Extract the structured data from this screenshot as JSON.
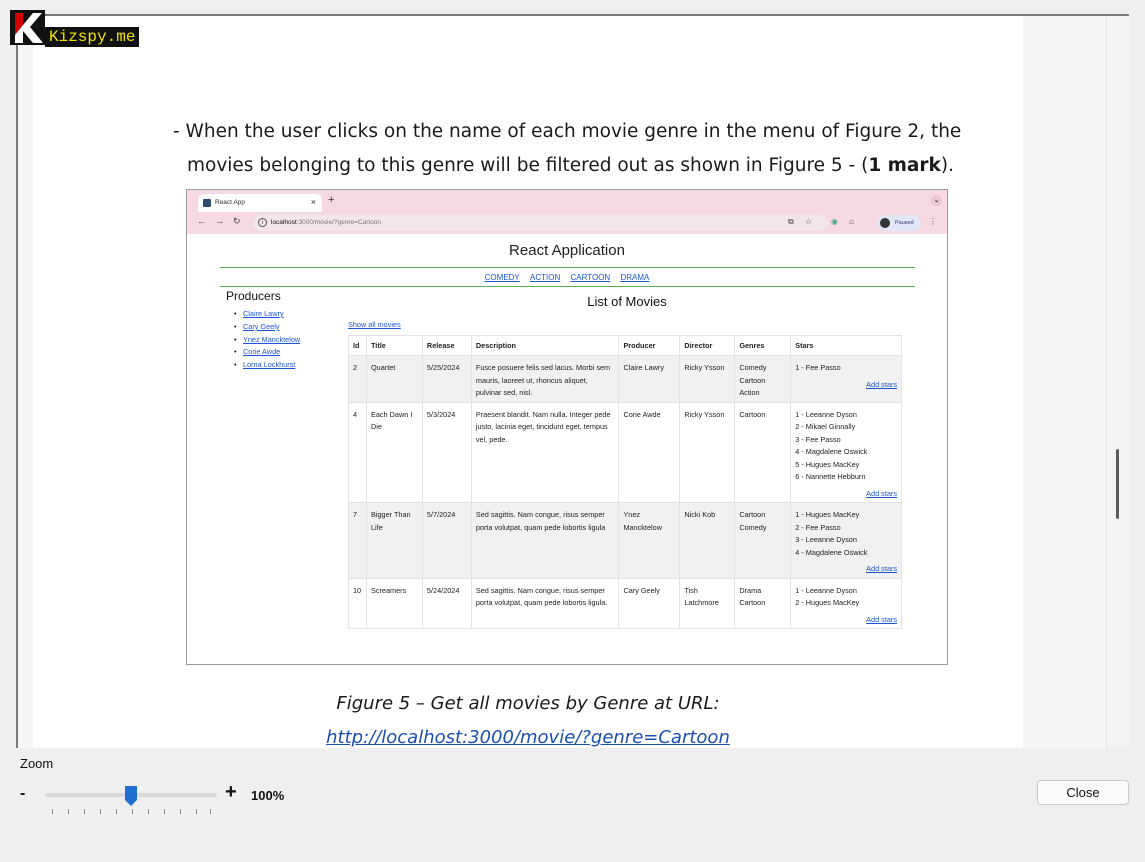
{
  "watermark": {
    "text": "Kizspy.me"
  },
  "document": {
    "line1": "- When the user clicks on the name of each movie genre in the menu of Figure 2, the",
    "line2_start": "movies belonging to this genre will be filtered out as shown in Figure 5  - (",
    "line2_bold": "1 mark",
    "line2_end": ").",
    "caption1": "Figure 5 – Get all movies by Genre at URL:",
    "caption2": "http://localhost:3000/movie/?genre=Cartoon"
  },
  "browser": {
    "tab_title": "React App",
    "tab_close": "×",
    "new_tab": "+",
    "url_host": "localhost",
    "url_path": ":3000/movie/?genre=Cartoon",
    "paused_label": "Paused",
    "icons": [
      "back-icon",
      "forward-icon",
      "reload-icon",
      "info-icon",
      "share-icon",
      "star-icon",
      "extension-icon",
      "puzzle-icon",
      "more-icon"
    ]
  },
  "app": {
    "title": "React Application",
    "genres": [
      "COMEDY",
      "ACTION",
      "CARTOON",
      "DRAMA"
    ],
    "producers_heading": "Producers",
    "producers": [
      "Claire Lawry",
      "Cary Geely",
      "Ynez Mancktelow",
      "Corie Awde",
      "Lorna Lockhurst"
    ],
    "list_heading": "List of Movies",
    "show_all": "Show all movies",
    "columns": [
      "Id",
      "Title",
      "Release",
      "Description",
      "Producer",
      "Director",
      "Genres",
      "Stars"
    ],
    "add_stars_label": "Add stars",
    "movies": [
      {
        "id": "2",
        "title": "Quartet",
        "release": "5/25/2024",
        "description": "Fusce posuere felis sed lacus. Morbi sem mauris, laoreet ut, rhoncus aliquet, pulvinar sed, nisl.",
        "producer": "Claire Lawry",
        "director": "Ricky Ysson",
        "genres": [
          "Comedy",
          "Cartoon",
          "Action"
        ],
        "stars": [
          "1 - Fee Passo"
        ]
      },
      {
        "id": "4",
        "title": "Each Dawn I Die",
        "release": "5/3/2024",
        "description": "Praesent blandit. Nam nulla. Integer pede justo, lacinia eget, tincidunt eget, tempus vel, pede.",
        "producer": "Corie Awde",
        "director": "Ricky Ysson",
        "genres": [
          "Cartoon"
        ],
        "stars": [
          "1 - Leeanne Dyson",
          "2 - Mikael Ginnally",
          "3 - Fee Passo",
          "4 - Magdalene Oswick",
          "5 - Hugues MacKey",
          "6 - Nannette Hebburn"
        ]
      },
      {
        "id": "7",
        "title": "Bigger Than Life",
        "release": "5/7/2024",
        "description": "Sed sagittis. Nam congue, risus semper porta volutpat, quam pede lobortis ligula",
        "producer": "Ynez Mancktelow",
        "director": "Nicki Kob",
        "genres": [
          "Cartoon",
          "Comedy"
        ],
        "stars": [
          "1 - Hugues MacKey",
          "2 - Fee Passo",
          "3 - Leeanne Dyson",
          "4 - Magdalene Oswick"
        ]
      },
      {
        "id": "10",
        "title": "Screamers",
        "release": "5/24/2024",
        "description": "Sed sagittis. Nam congue, risus semper porta volutpat, quam pede lobortis ligula.",
        "producer": "Cary Geely",
        "director": "Tish Latchmore",
        "genres": [
          "Drama",
          "Cartoon"
        ],
        "stars": [
          "1 - Leeanne Dyson",
          "2 - Hugues MacKey"
        ]
      }
    ]
  },
  "viewer": {
    "zoom_label": "Zoom",
    "zoom_minus": "-",
    "zoom_plus": "+",
    "zoom_value": "100%",
    "zoom_level_fraction": 0.5,
    "close_label": "Close"
  },
  "colors": {
    "accent": "#1a55d6",
    "tab_bar": "#f6d9e3",
    "menu_rule": "#5aa95a",
    "slider_thumb": "#1f6fd1"
  }
}
